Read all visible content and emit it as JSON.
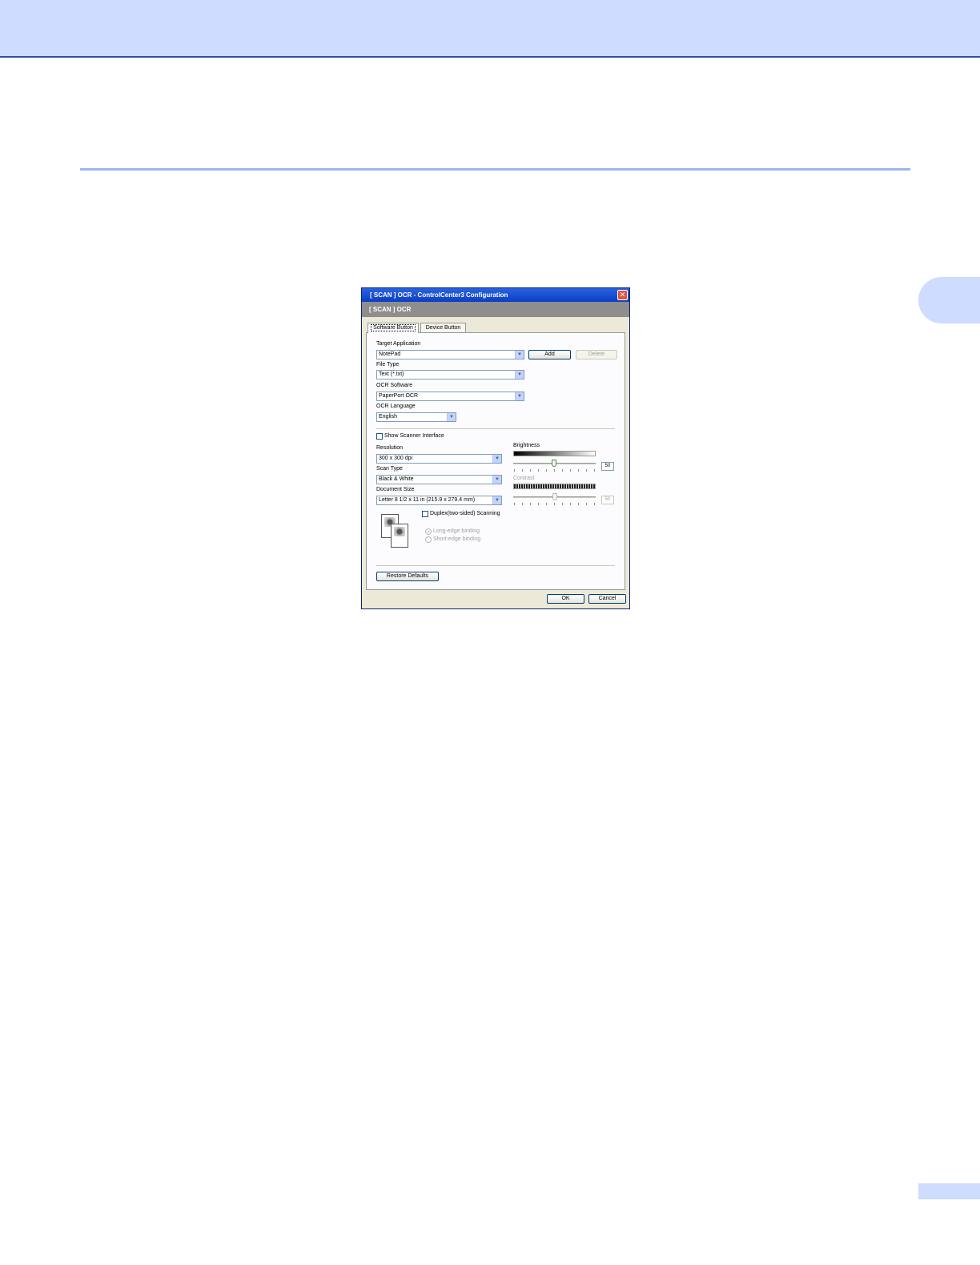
{
  "dialog": {
    "title": "[ SCAN ]  OCR - ControlCenter3 Configuration",
    "header": "[ SCAN ]  OCR",
    "close_glyph": "✕",
    "tabs": [
      {
        "label": "Software Button",
        "active": true
      },
      {
        "label": "Device Button",
        "active": false
      }
    ],
    "target_application": {
      "label": "Target Application",
      "value": "NotePad"
    },
    "add_label": "Add",
    "delete_label": "Delete",
    "file_type": {
      "label": "File Type",
      "value": "Text (*.txt)"
    },
    "ocr_software": {
      "label": "OCR Software",
      "value": "PaperPort OCR"
    },
    "ocr_language": {
      "label": "OCR Language",
      "value": "English"
    },
    "show_scanner_interface": {
      "label": "Show Scanner Interface",
      "checked": false
    },
    "resolution": {
      "label": "Resolution",
      "value": "300 x 300 dpi"
    },
    "scan_type": {
      "label": "Scan Type",
      "value": "Black & White"
    },
    "document_size": {
      "label": "Document Size",
      "value": "Letter 8 1/2 x 11 in (215.9 x 279.4 mm)"
    },
    "duplex": {
      "label": "Duplex(two-sided) Scanning",
      "checked": false
    },
    "long_edge": {
      "label": "Long-edge binding",
      "selected": true
    },
    "short_edge": {
      "label": "Short-edge binding",
      "selected": false
    },
    "brightness": {
      "label": "Brightness",
      "value": "50"
    },
    "contrast": {
      "label": "Contrast",
      "value": "50"
    },
    "restore_defaults_label": "Restore Defaults",
    "ok_label": "OK",
    "cancel_label": "Cancel",
    "arrow_glyph": "▼",
    "icons": {
      "close": "close-icon",
      "dropdown": "chevron-down-icon",
      "document": "duplex-document-icon"
    },
    "colors": {
      "titlebar": "#0b3fc4",
      "header": "#8e8e8e",
      "page_accent": "#cddcff"
    }
  }
}
